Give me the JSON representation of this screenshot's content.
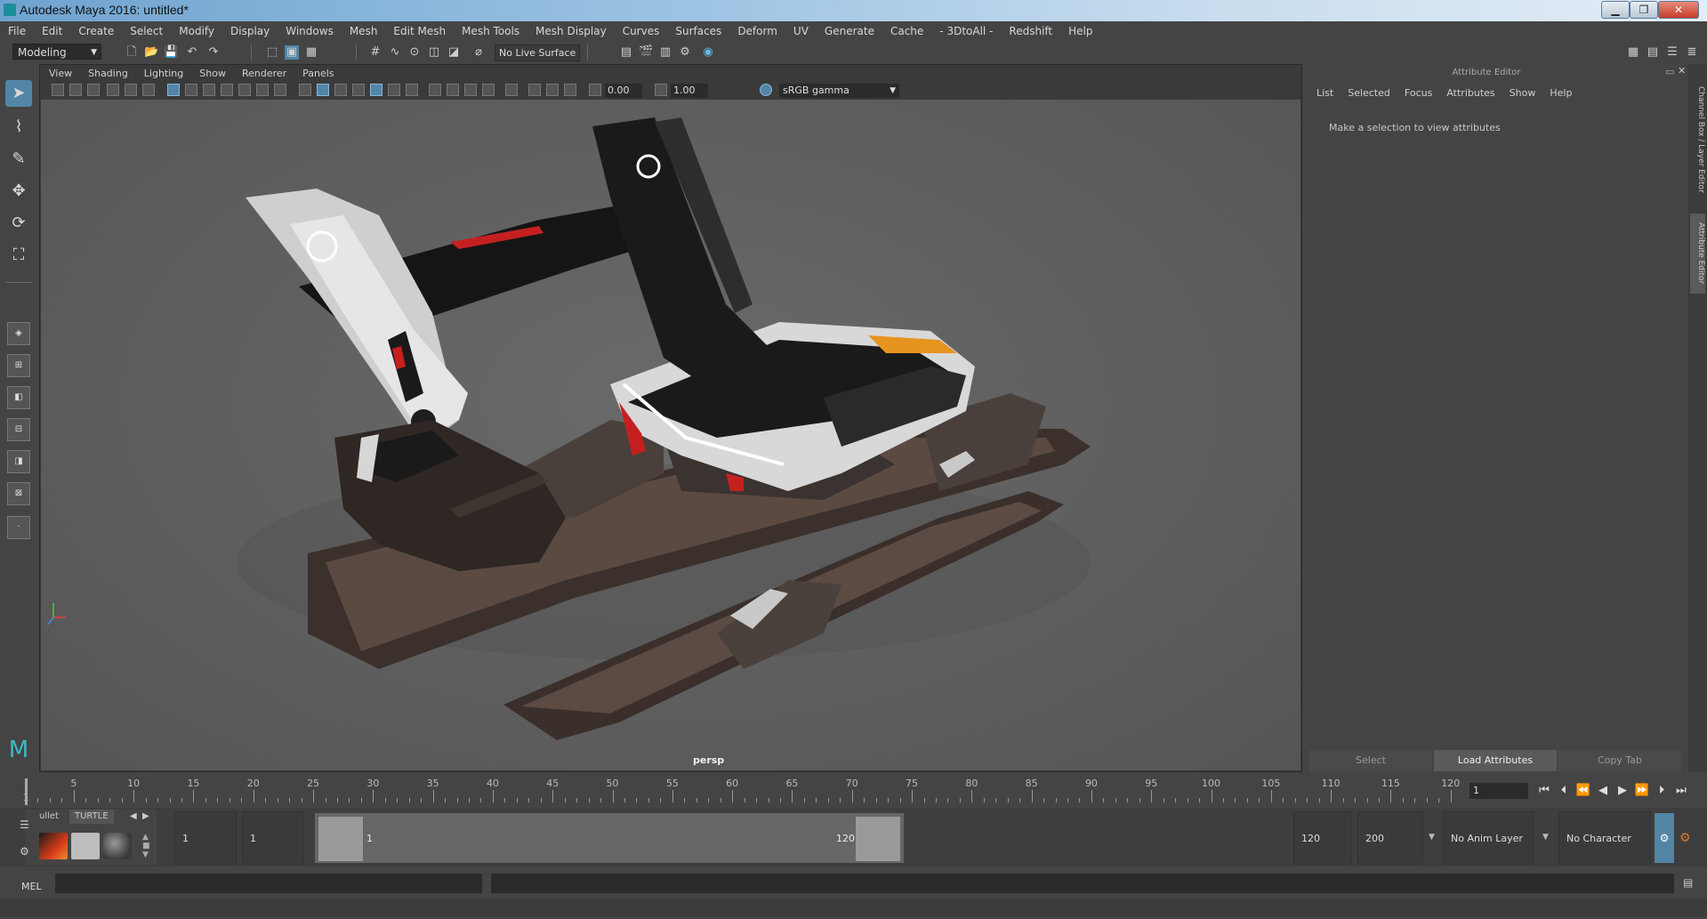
{
  "window": {
    "title": "Autodesk Maya 2016: untitled*"
  },
  "menu": [
    "File",
    "Edit",
    "Create",
    "Select",
    "Modify",
    "Display",
    "Windows",
    "Mesh",
    "Edit Mesh",
    "Mesh Tools",
    "Mesh Display",
    "Curves",
    "Surfaces",
    "Deform",
    "UV",
    "Generate",
    "Cache",
    "- 3DtoAll -",
    "Redshift",
    "Help"
  ],
  "status": {
    "mode": "Modeling",
    "live_surface": "No Live Surface"
  },
  "viewport": {
    "menu": [
      "View",
      "Shading",
      "Lighting",
      "Show",
      "Renderer",
      "Panels"
    ],
    "exposure": "0.00",
    "gamma": "1.00",
    "color_space": "sRGB gamma",
    "camera": "persp"
  },
  "attribute_editor": {
    "title": "Attribute Editor",
    "menu": [
      "List",
      "Selected",
      "Focus",
      "Attributes",
      "Show",
      "Help"
    ],
    "message": "Make a selection to view attributes",
    "buttons": [
      "Select",
      "Load Attributes",
      "Copy Tab"
    ],
    "side_tabs": [
      "Channel Box / Layer Editor",
      "Attribute Editor"
    ]
  },
  "timeline": {
    "ticks": [
      "5",
      "10",
      "15",
      "20",
      "25",
      "30",
      "35",
      "40",
      "45",
      "50",
      "55",
      "60",
      "65",
      "70",
      "75",
      "80",
      "85",
      "90",
      "95",
      "100",
      "105",
      "110",
      "115",
      "120"
    ],
    "start_label": "1",
    "current_frame": "1"
  },
  "range": {
    "start": "1",
    "playback_start": "1",
    "slider_start": "1",
    "slider_end": "120",
    "playback_end": "120",
    "end": "200",
    "anim_layer": "No Anim Layer",
    "character_set": "No Character Set"
  },
  "shelf": {
    "tabs": [
      "ullet",
      "TURTLE"
    ]
  },
  "command": {
    "label": "MEL"
  },
  "colors": {
    "accent": "#5285a6",
    "panel": "#444444",
    "viewport": "#5e5e5e"
  }
}
